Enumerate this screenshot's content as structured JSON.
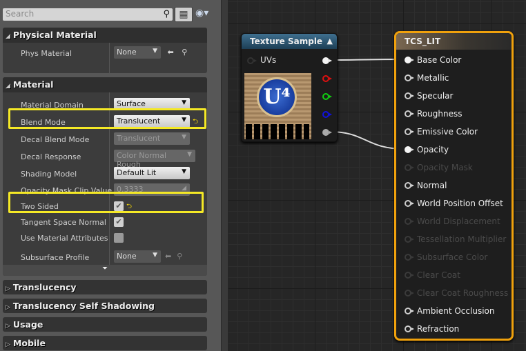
{
  "search": {
    "placeholder": "Search",
    "icon": "search-icon"
  },
  "toolbar": {
    "grid_icon": "list-view-icon",
    "eye_icon": "eye-icon"
  },
  "physical_material": {
    "title": "Physical Material",
    "rows": [
      {
        "label": "Phys Material",
        "value": "None"
      }
    ]
  },
  "material": {
    "title": "Material",
    "rows": [
      {
        "label": "Material Domain",
        "type": "combo",
        "value": "Surface"
      },
      {
        "label": "Blend Mode",
        "type": "combo",
        "value": "Translucent",
        "reset": true,
        "highlighted": true
      },
      {
        "label": "Decal Blend Mode",
        "type": "combo",
        "value": "Translucent",
        "disabled": true
      },
      {
        "label": "Decal Response",
        "type": "combo",
        "value": "Color Normal Rough",
        "disabled": true
      },
      {
        "label": "Shading Model",
        "type": "combo",
        "value": "Default Lit"
      },
      {
        "label": "Opacity Mask Clip Value",
        "type": "number",
        "value": "0.3333",
        "disabled": true
      },
      {
        "label": "Two Sided",
        "type": "check",
        "checked": true,
        "reset": true,
        "highlighted": true
      },
      {
        "label": "Tangent Space Normal",
        "type": "check",
        "checked": true
      },
      {
        "label": "Use Material Attributes",
        "type": "check",
        "checked": false
      },
      {
        "label": "Subsurface Profile",
        "type": "asset",
        "value": "None",
        "disabled": true
      }
    ]
  },
  "collapsed_sections": [
    "Translucency",
    "Translucency Self Shadowing",
    "Usage",
    "Mobile"
  ],
  "texture_node": {
    "title": "Texture Sample",
    "input": "UVs",
    "outputs": [
      "rgb",
      "r",
      "g",
      "b",
      "a"
    ],
    "colors": {
      "r": "#e01010",
      "g": "#10d010",
      "b": "#1010e0"
    }
  },
  "material_node": {
    "title": "TCS_LIT",
    "accent": "#f0a10c",
    "inputs": [
      {
        "label": "Base Color",
        "state": "connected"
      },
      {
        "label": "Metallic",
        "state": "enabled"
      },
      {
        "label": "Specular",
        "state": "enabled"
      },
      {
        "label": "Roughness",
        "state": "enabled"
      },
      {
        "label": "Emissive Color",
        "state": "enabled"
      },
      {
        "label": "Opacity",
        "state": "connected"
      },
      {
        "label": "Opacity Mask",
        "state": "disabled"
      },
      {
        "label": "Normal",
        "state": "enabled"
      },
      {
        "label": "World Position Offset",
        "state": "enabled"
      },
      {
        "label": "World Displacement",
        "state": "disabled"
      },
      {
        "label": "Tessellation Multiplier",
        "state": "disabled"
      },
      {
        "label": "Subsurface Color",
        "state": "disabled"
      },
      {
        "label": "Clear Coat",
        "state": "disabled"
      },
      {
        "label": "Clear Coat Roughness",
        "state": "disabled"
      },
      {
        "label": "Ambient Occlusion",
        "state": "enabled"
      },
      {
        "label": "Refraction",
        "state": "enabled"
      }
    ]
  }
}
